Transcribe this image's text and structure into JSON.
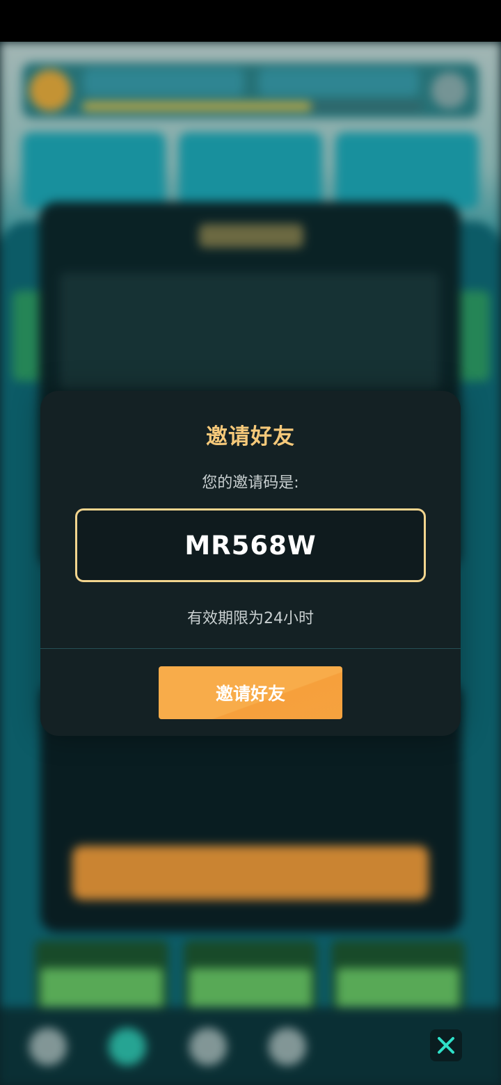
{
  "dialog": {
    "title": "邀请好友",
    "prompt": "您的邀请码是:",
    "invite_code": "MR568W",
    "validity": "有效期限为24小时",
    "invite_button_label": "邀请好友"
  },
  "icons": {
    "close": "close-icon"
  },
  "colors": {
    "title": "#f6c97a",
    "code_border": "#f3d58e",
    "button": "#f8ac4a",
    "dialog_bg": "#142124",
    "close_icon": "#2fe0c8"
  }
}
